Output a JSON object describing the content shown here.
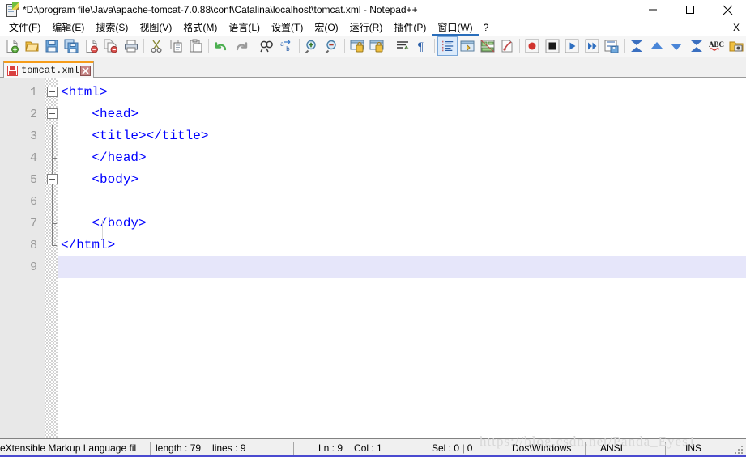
{
  "window": {
    "title": "*D:\\program file\\Java\\apache-tomcat-7.0.88\\conf\\Catalina\\localhost\\tomcat.xml - Notepad++",
    "app_icon": "notepad-plus-plus-icon",
    "controls": {
      "minimize": "minimize-icon",
      "maximize": "maximize-icon",
      "close": "close-icon"
    }
  },
  "menubar": {
    "items": [
      {
        "label": "文件(F)"
      },
      {
        "label": "编辑(E)"
      },
      {
        "label": "搜索(S)"
      },
      {
        "label": "视图(V)"
      },
      {
        "label": "格式(M)"
      },
      {
        "label": "语言(L)"
      },
      {
        "label": "设置(T)"
      },
      {
        "label": "宏(O)"
      },
      {
        "label": "运行(R)"
      },
      {
        "label": "插件(P)"
      },
      {
        "label": "窗口(W)"
      },
      {
        "label": "?"
      }
    ],
    "right_close": "X"
  },
  "toolbar": {
    "groups": [
      [
        "new-file-icon",
        "open-file-icon",
        "save-icon",
        "save-all-icon",
        "close-file-icon",
        "close-all-icon",
        "print-icon"
      ],
      [
        "cut-icon",
        "copy-icon",
        "paste-icon"
      ],
      [
        "undo-icon",
        "redo-icon"
      ],
      [
        "find-icon",
        "replace-icon"
      ],
      [
        "zoom-in-icon",
        "zoom-out-icon"
      ],
      [
        "sync-vertical-scroll-icon",
        "sync-horizontal-scroll-icon"
      ],
      [
        "word-wrap-icon",
        "show-all-characters-icon"
      ],
      [
        "indent-guide-icon",
        "user-defined-dialog-icon",
        "document-map-icon",
        "function-list-icon"
      ],
      [
        "start-record-macro-icon",
        "stop-record-macro-icon",
        "play-macro-icon",
        "run-macro-multiple-icon",
        "save-macro-icon"
      ],
      [
        "collapse-all-icon",
        "collapse-level-icon",
        "expand-level-icon",
        "expand-all-icon",
        "spell-check-icon",
        "run-icon"
      ]
    ],
    "selected": "indent-guide-icon"
  },
  "tabs": [
    {
      "label": "tomcat.xml",
      "icon": "unsaved-disk-icon",
      "close": "tab-close-icon",
      "active": true
    }
  ],
  "editor": {
    "lines": [
      {
        "num": "1",
        "text": "<html>",
        "fold": "box",
        "indent": 0
      },
      {
        "num": "2",
        "text": "    <head>",
        "fold": "box",
        "indent": 1
      },
      {
        "num": "3",
        "text": "    <title></title>",
        "fold": "line",
        "indent": 1
      },
      {
        "num": "4",
        "text": "    </head>",
        "fold": "tick",
        "indent": 1
      },
      {
        "num": "5",
        "text": "    <body>",
        "fold": "box",
        "indent": 1
      },
      {
        "num": "6",
        "text": "",
        "fold": "line",
        "indent": 1
      },
      {
        "num": "7",
        "text": "    </body>",
        "fold": "tick",
        "indent": 1
      },
      {
        "num": "8",
        "text": "</html>",
        "fold": "end",
        "indent": 0
      },
      {
        "num": "9",
        "text": "",
        "fold": "none",
        "indent": 0
      }
    ],
    "current_line": "9",
    "text_color": "#0000ff",
    "current_line_color": "#e6e6fa"
  },
  "statusbar": {
    "language": "eXtensible Markup Language fil",
    "length": "length : 79",
    "lines": "lines : 9",
    "ln": "Ln : 9",
    "col": "Col : 1",
    "sel": "Sel : 0 | 0",
    "eol": "Dos\\Windows",
    "encoding": "ANSI",
    "insert_mode": "INS"
  },
  "watermark": "https://blog.csdn.net/Panda_Eyes1"
}
